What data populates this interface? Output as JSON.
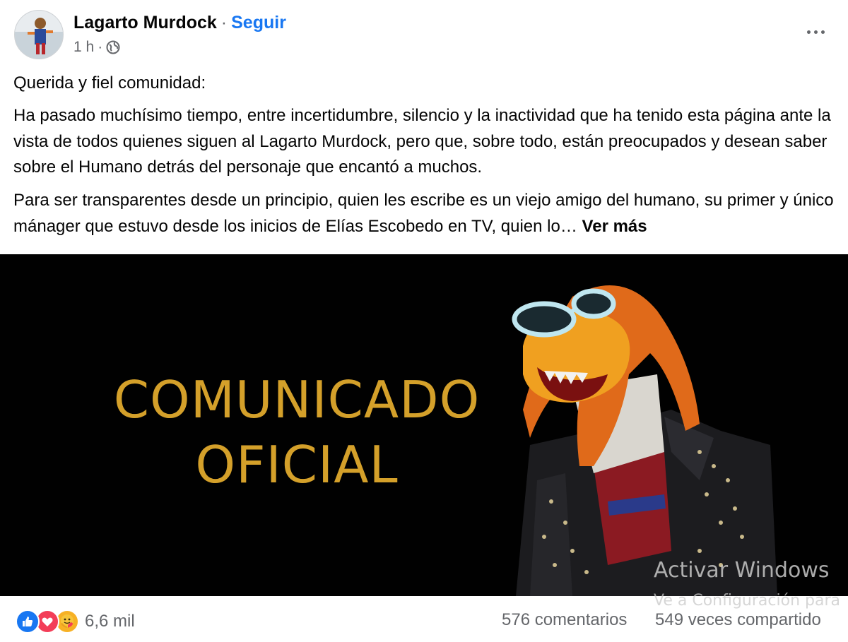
{
  "header": {
    "author_name": "Lagarto Murdock",
    "separator": "·",
    "follow_label": "Seguir",
    "time": "1 h",
    "meta_separator": "·",
    "privacy_icon": "globe-icon",
    "more_icon": "more-options-icon"
  },
  "post": {
    "paragraph1": "Querida y fiel comunidad:",
    "paragraph2": "Ha pasado muchísimo tiempo, entre incertidumbre, silencio y la inactividad que ha tenido esta página ante la vista de todos quienes siguen al Lagarto Murdock, pero que, sobre todo, están preocupados y desean saber sobre el Humano detrás del personaje que encantó a muchos.",
    "paragraph3": "Para ser transparentes desde un principio, quien les escribe es un viejo amigo del humano, su primer y único mánager que estuvo desde los inicios de Elías Escobedo en TV, quien lo…",
    "see_more": "Ver más"
  },
  "image": {
    "title_line1": "COMUNICADO",
    "title_line2": "OFICIAL",
    "title_color": "#d4a02a"
  },
  "watermark": {
    "line1": "Activar Windows",
    "line2": "Ve a Configuración para"
  },
  "footer": {
    "reactions": [
      "like-icon",
      "love-icon",
      "care-icon"
    ],
    "reaction_count": "6,6 mil",
    "comments": "576 comentarios",
    "shares": "549 veces compartido"
  },
  "colors": {
    "link_blue": "#1877f2",
    "secondary_text": "#65676b",
    "like": "#1877f2",
    "love": "#f33e58",
    "care": "#f7b125"
  }
}
